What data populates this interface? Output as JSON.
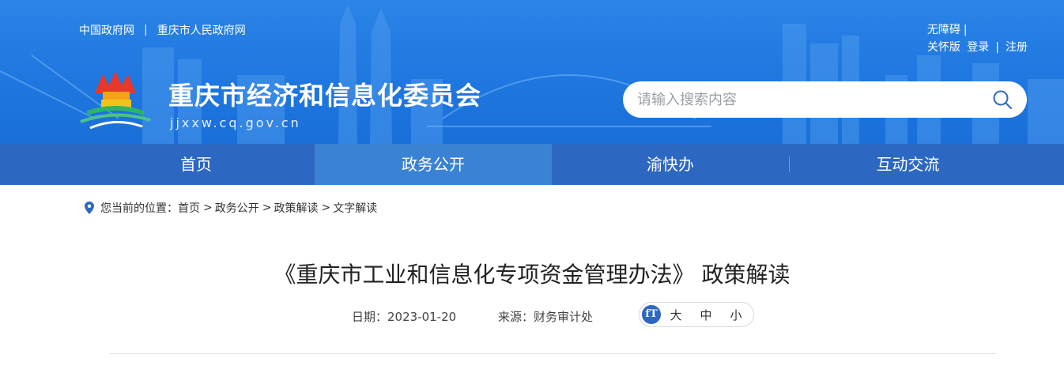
{
  "header": {
    "top_links": [
      "中国政府网",
      "重庆市人民政府网"
    ],
    "top_separator": "|",
    "accessibility": "无障碍",
    "care_mode": "关怀版",
    "login": "登录",
    "register": "注册",
    "site_title": "重庆市经济和信息化委员会",
    "site_domain": "jjxxw.cq.gov.cn",
    "search_placeholder": "请输入搜索内容",
    "brand_color": "#1f77e0"
  },
  "nav": {
    "items": [
      "首页",
      "政务公开",
      "渝快办",
      "互动交流"
    ],
    "active_index": 1,
    "bar_color": "#2c67c2",
    "active_color": "#3a82d3"
  },
  "breadcrumb": {
    "prefix": "您当前的位置：",
    "items": [
      "首页",
      "政务公开",
      "政策解读",
      "文字解读"
    ],
    "arrow": ">"
  },
  "article": {
    "title": "《重庆市工业和信息化专项资金管理办法》 政策解读",
    "date": "日期：2023-01-20",
    "source": "来源：财务审计处",
    "font_size_icon": "fT",
    "font_sizes": [
      "大",
      "中",
      "小"
    ]
  }
}
